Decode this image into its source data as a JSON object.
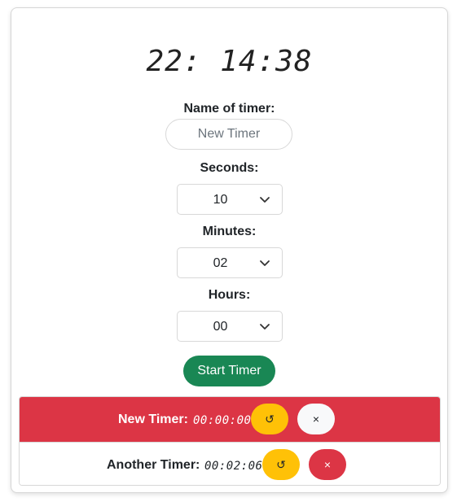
{
  "clock": {
    "time": "22: 14:38"
  },
  "form": {
    "name_label": "Name of timer:",
    "name_placeholder": "New Timer",
    "seconds_label": "Seconds:",
    "seconds_value": "10",
    "minutes_label": "Minutes:",
    "minutes_value": "02",
    "hours_label": "Hours:",
    "hours_value": "00",
    "start_label": "Start Timer"
  },
  "timers": [
    {
      "name": "New Timer:",
      "time": "00:00:00",
      "reset_glyph": "↺",
      "close_glyph": "×",
      "state": "finished"
    },
    {
      "name": "Another Timer:",
      "time": "00:02:06",
      "reset_glyph": "↺",
      "close_glyph": "×",
      "state": "running"
    }
  ],
  "colors": {
    "start": "#198754",
    "finished_row": "#dc3545",
    "reset": "#ffc107",
    "close_danger": "#dc3545",
    "close_light": "#f8f9fa"
  },
  "icons": {
    "reset": "reset-icon",
    "close": "close-icon",
    "select": "chevron-down-icon"
  }
}
